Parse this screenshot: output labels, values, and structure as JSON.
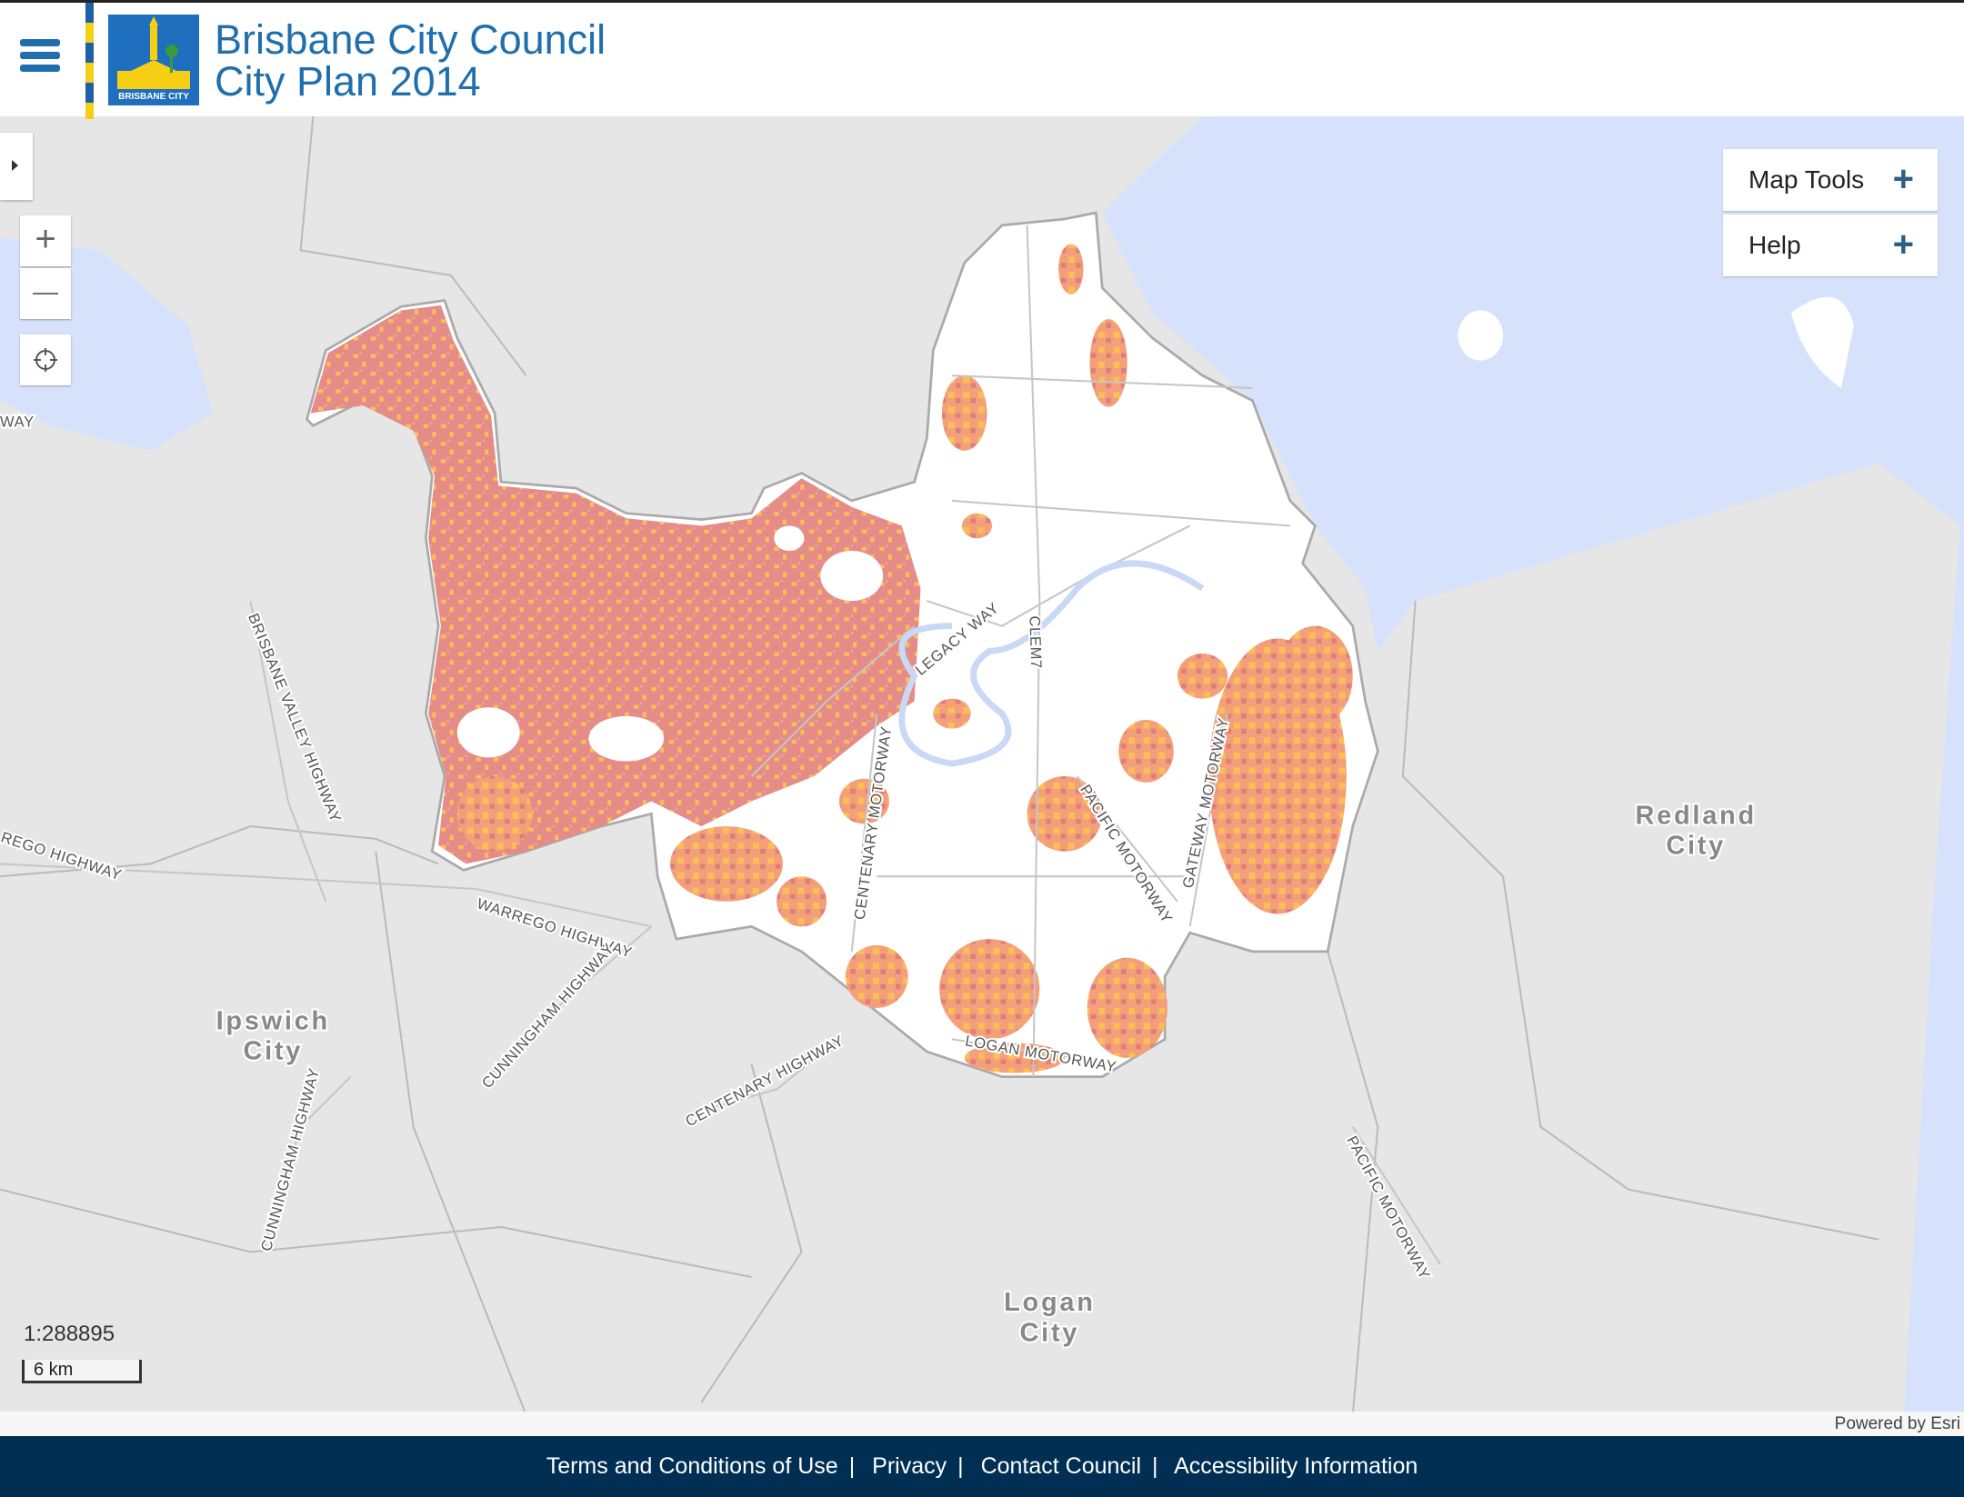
{
  "header": {
    "title_line1": "Brisbane City Council",
    "title_line2": "City Plan 2014",
    "logo_text": "BRISBANE CITY",
    "menu_icon": "hamburger-icon"
  },
  "map_controls": {
    "zoom_in": "+",
    "zoom_out": "—",
    "locate_icon": "crosshair-icon"
  },
  "panel": [
    {
      "label": "Map Tools",
      "icon": "plus-icon"
    },
    {
      "label": "Help",
      "icon": "plus-icon"
    }
  ],
  "map": {
    "city_labels": [
      [
        "Ipswich",
        "City"
      ],
      [
        "Redland",
        "City"
      ],
      [
        "Logan",
        "City"
      ]
    ],
    "road_labels": [
      "WAY",
      "BRISBANE VALLEY HIGHWAY",
      "REGO HIGHWAY",
      "WARREGO HIGHWAY",
      "CUNNINGHAM HIGHWAY",
      "CUNNINGHAM HIGHWAY",
      "CENTENARY HIGHWAY",
      "CENTENARY MOTORWAY",
      "LEGACY WAY",
      "CLEM7",
      "PACIFIC MOTORWAY",
      "GATEWAY MOTORWAY",
      "LOGAN MOTORWAY",
      "PACIFIC MOTORWAY"
    ],
    "scale_ratio": "1:288895",
    "scale_bar": "6 km",
    "attribution": "Powered by Esri",
    "colors": {
      "land": "#e6e6e6",
      "water": "#d6e2fb",
      "brisbane": "#ffffff",
      "overlay_red": "#e58c88",
      "overlay_orange": "#fbbf56"
    }
  },
  "footer": {
    "links": [
      "Terms and Conditions of Use",
      "Privacy",
      "Contact Council",
      "Accessibility Information"
    ]
  }
}
